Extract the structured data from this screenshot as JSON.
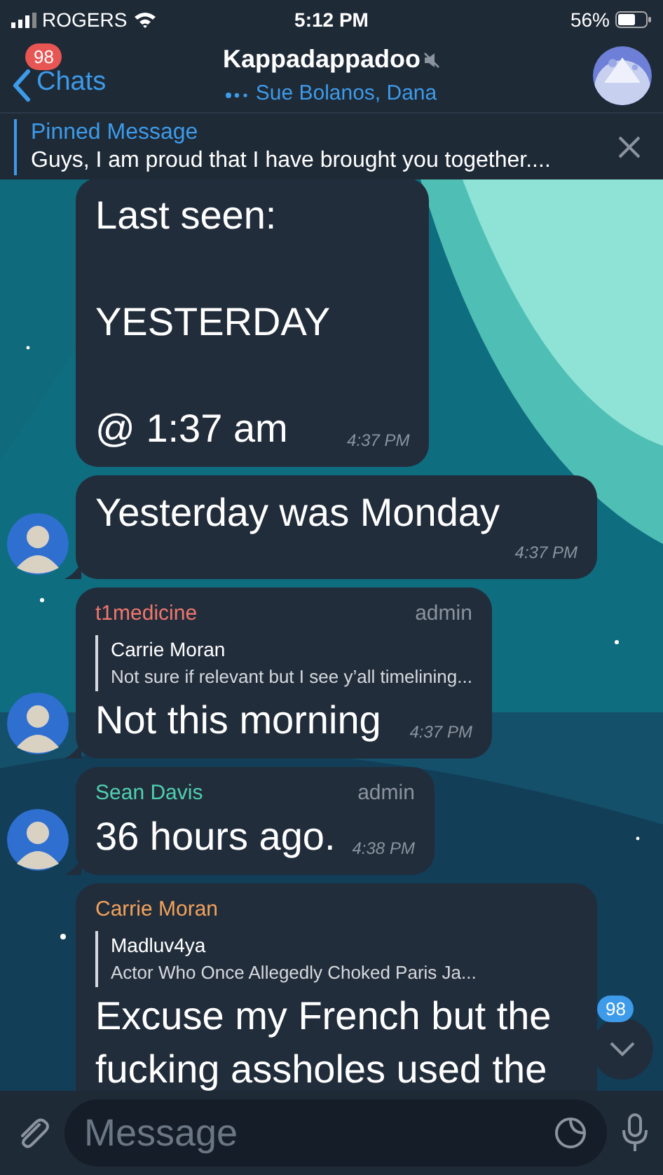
{
  "status_bar": {
    "carrier": "ROGERS",
    "time": "5:12 PM",
    "battery": "56%"
  },
  "nav": {
    "back_label": "Chats",
    "back_badge": "98",
    "title": "Kappadappadoo",
    "muted": true,
    "subtitle": "Sue Bolanos, Dana",
    "typing": true
  },
  "pinned": {
    "label": "Pinned Message",
    "text": "Guys, I am proud that I have brought you together...."
  },
  "messages": [
    {
      "text": "Last seen:\n\nYESTERDAY\n\n@ 1:37 am",
      "time": "4:37 PM",
      "avatar": false
    },
    {
      "text": "Yesterday was Monday",
      "time": "4:37 PM",
      "avatar": true
    },
    {
      "sender": "t1medicine",
      "color": "#f0776c",
      "role": "admin",
      "reply": {
        "author": "Carrie Moran",
        "text": "Not sure if relevant but I see y’all timelining..."
      },
      "text": "Not this morning",
      "time": "4:37 PM",
      "avatar": true
    },
    {
      "sender": "Sean Davis",
      "color": "#4fcfb0",
      "role": "admin",
      "text": "36 hours ago.",
      "time": "4:38 PM",
      "avatar": true
    },
    {
      "sender": "Carrie Moran",
      "color": "#f3a25a",
      "reply": {
        "author": "Madluv4ya",
        "text": "Actor Who Once Allegedly Choked Paris Ja..."
      },
      "text": "Excuse my French but the fucking assholes used the"
    }
  ],
  "scroll_down": {
    "badge": "98"
  },
  "composer": {
    "placeholder": "Message"
  }
}
